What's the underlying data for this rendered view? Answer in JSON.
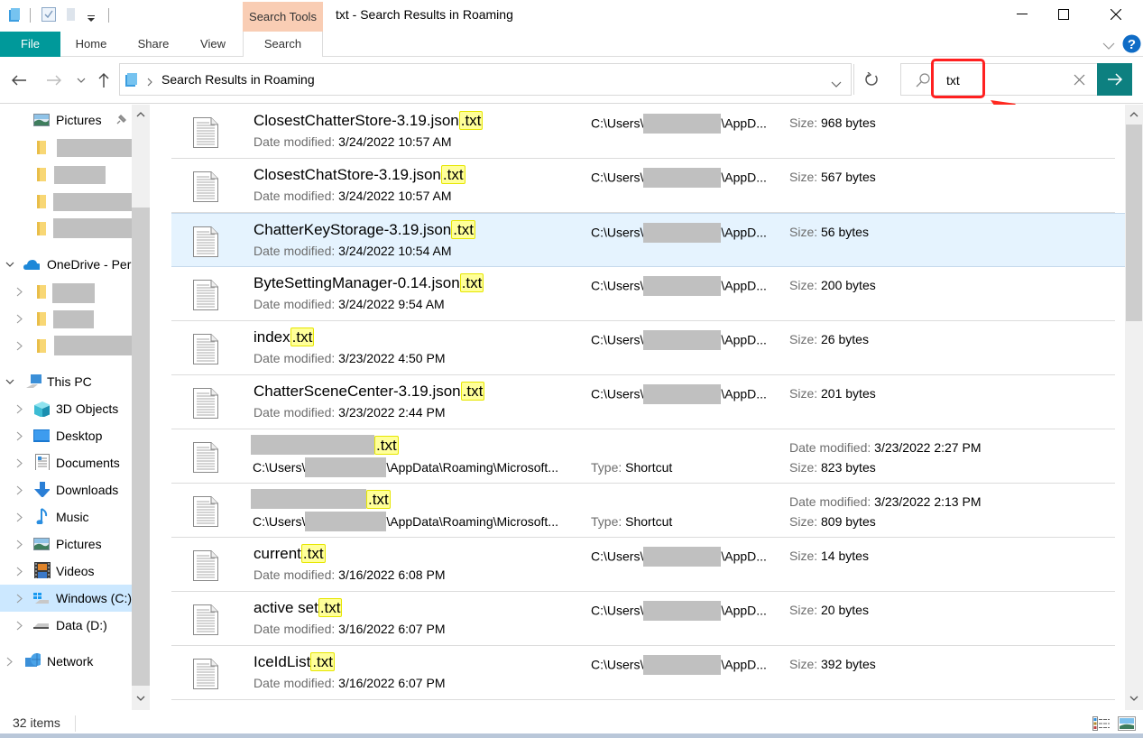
{
  "window": {
    "title": "txt - Search Results in Roaming",
    "contextual_tab_group": "Search Tools"
  },
  "ribbon": {
    "tabs": [
      {
        "label": "File",
        "active": false
      },
      {
        "label": "Home"
      },
      {
        "label": "Share"
      },
      {
        "label": "View"
      },
      {
        "label": "Search",
        "active": true
      }
    ]
  },
  "address_bar": {
    "breadcrumb": "Search Results in Roaming"
  },
  "search": {
    "value": "txt",
    "placeholder": ""
  },
  "sidebar": {
    "items": [
      {
        "label": "Pictures",
        "icon": "pictures-icon",
        "pinned": true
      },
      {
        "label": "",
        "icon": "folder-icon",
        "redacted": true
      },
      {
        "label": "",
        "icon": "folder-icon",
        "redacted": true
      },
      {
        "label": "",
        "icon": "folder-icon",
        "redacted": true
      },
      {
        "label": "",
        "icon": "folder-icon",
        "redacted": true
      },
      {
        "label": "OneDrive - Per",
        "icon": "onedrive-icon",
        "expanded": true
      },
      {
        "label": "",
        "icon": "folder-icon",
        "redacted": true
      },
      {
        "label": "",
        "icon": "folder-icon",
        "redacted": true
      },
      {
        "label": "",
        "icon": "folder-icon",
        "redacted": true
      },
      {
        "label": "This PC",
        "icon": "this-pc-icon",
        "expanded": true
      },
      {
        "label": "3D Objects",
        "icon": "3d-objects-icon"
      },
      {
        "label": "Desktop",
        "icon": "desktop-icon"
      },
      {
        "label": "Documents",
        "icon": "documents-icon"
      },
      {
        "label": "Downloads",
        "icon": "downloads-icon"
      },
      {
        "label": "Music",
        "icon": "music-icon"
      },
      {
        "label": "Pictures",
        "icon": "pictures-icon"
      },
      {
        "label": "Videos",
        "icon": "videos-icon"
      },
      {
        "label": "Windows (C:)",
        "icon": "windows-drive-icon",
        "selected": true
      },
      {
        "label": "Data (D:)",
        "icon": "drive-icon"
      },
      {
        "label": "Network",
        "icon": "network-icon"
      }
    ]
  },
  "results": {
    "labels": {
      "date_modified": "Date modified: ",
      "size": "Size: ",
      "type": "Type: "
    },
    "items": [
      {
        "name": "ClosestChatterStore-3.19.json",
        "ext": ".txt",
        "date": "3/24/2022 10:57 AM",
        "path_prefix": "C:\\Users\\",
        "path_suffix": "\\AppD...",
        "size": "968 bytes"
      },
      {
        "name": "ClosestChatStore-3.19.json",
        "ext": ".txt",
        "date": "3/24/2022 10:57 AM",
        "path_prefix": "C:\\Users\\",
        "path_suffix": "\\AppD...",
        "size": "567 bytes"
      },
      {
        "name": "ChatterKeyStorage-3.19.json",
        "ext": ".txt",
        "date": "3/24/2022 10:54 AM",
        "path_prefix": "C:\\Users\\",
        "path_suffix": "\\AppD...",
        "size": "56 bytes",
        "selected": true
      },
      {
        "name": "ByteSettingManager-0.14.json",
        "ext": ".txt",
        "date": "3/24/2022 9:54 AM",
        "path_prefix": "C:\\Users\\",
        "path_suffix": "\\AppD...",
        "size": "200 bytes"
      },
      {
        "name": "index",
        "ext": ".txt",
        "date": "3/23/2022 4:50 PM",
        "path_prefix": "C:\\Users\\",
        "path_suffix": "\\AppD...",
        "size": "26 bytes"
      },
      {
        "name": "ChatterSceneCenter-3.19.json",
        "ext": ".txt",
        "date": "3/23/2022 2:44 PM",
        "path_prefix": "C:\\Users\\",
        "path_suffix": "\\AppD...",
        "size": "201 bytes"
      },
      {
        "name": "",
        "ext": ".txt",
        "shortcut": true,
        "path_prefix": "C:\\Users\\",
        "path_suffix": "\\AppData\\Roaming\\Microsoft...",
        "type": "Shortcut",
        "date": "3/23/2022 2:27 PM",
        "size": "823 bytes"
      },
      {
        "name": "",
        "ext": ".txt",
        "shortcut": true,
        "path_prefix": "C:\\Users\\",
        "path_suffix": "\\AppData\\Roaming\\Microsoft...",
        "type": "Shortcut",
        "date": "3/23/2022 2:13 PM",
        "size": "809 bytes"
      },
      {
        "name": "current",
        "ext": ".txt",
        "date": "3/16/2022 6:08 PM",
        "path_prefix": "C:\\Users\\",
        "path_suffix": "\\AppD...",
        "size": "14 bytes"
      },
      {
        "name": "active set",
        "ext": ".txt",
        "date": "3/16/2022 6:07 PM",
        "path_prefix": "C:\\Users\\",
        "path_suffix": "\\AppD...",
        "size": "20 bytes"
      },
      {
        "name": "IceIdList",
        "ext": ".txt",
        "date": "3/16/2022 6:07 PM",
        "path_prefix": "C:\\Users\\",
        "path_suffix": "\\AppD...",
        "size": "392 bytes"
      }
    ]
  },
  "status": {
    "item_count": "32 items"
  },
  "colors": {
    "file_tab": "#00999a",
    "search_tools": "#f9cdb4",
    "search_go": "#0d8080",
    "highlight": "#ffff99",
    "selection": "#e5f3fe",
    "annotation": "#ff2020"
  }
}
